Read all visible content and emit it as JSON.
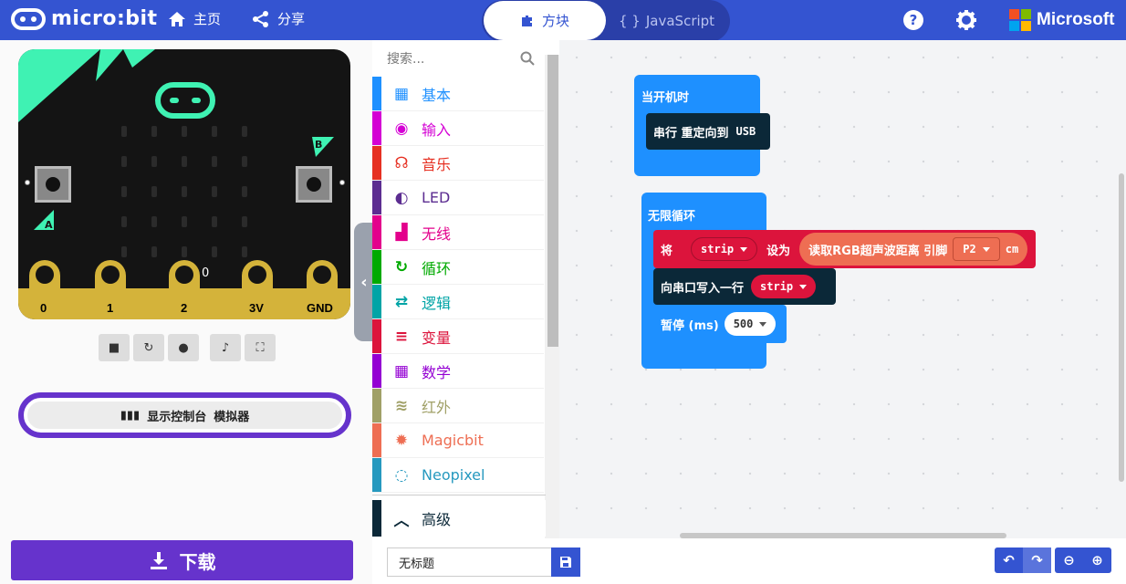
{
  "header": {
    "logo_text": "micro:bit",
    "home_label": "主页",
    "share_label": "分享",
    "mode_blocks": "方块",
    "mode_javascript": "JavaScript",
    "brand": "Microsoft",
    "help_icon": "help-icon",
    "settings_icon": "gear-icon"
  },
  "simulator": {
    "pin_labels": [
      "0",
      "1",
      "2",
      "3V",
      "GND"
    ],
    "pin_readout": "0",
    "button_a": "A",
    "button_b": "B",
    "console_label": "显示控制台",
    "console_sub": "模拟器",
    "download_label": "下载"
  },
  "toolbox": {
    "search_placeholder": "搜索...",
    "categories": [
      {
        "label": "基本",
        "color": "#1E90FF",
        "icon": "grid-icon"
      },
      {
        "label": "输入",
        "color": "#D400D4",
        "icon": "target-icon"
      },
      {
        "label": "音乐",
        "color": "#E63022",
        "icon": "headphones-icon"
      },
      {
        "label": "LED",
        "color": "#5C2D91",
        "icon": "toggle-icon"
      },
      {
        "label": "无线",
        "color": "#E3008C",
        "icon": "signal-icon"
      },
      {
        "label": "循环",
        "color": "#00AA00",
        "icon": "refresh-icon"
      },
      {
        "label": "逻辑",
        "color": "#00A4A6",
        "icon": "shuffle-icon"
      },
      {
        "label": "变量",
        "color": "#DC143C",
        "icon": "list-icon"
      },
      {
        "label": "数学",
        "color": "#9400D3",
        "icon": "calculator-icon"
      },
      {
        "label": "红外",
        "color": "#A0A067",
        "icon": "wifi-icon"
      },
      {
        "label": "Magicbit",
        "color": "#EE6E53",
        "icon": "gear-icon"
      },
      {
        "label": "Neopixel",
        "color": "#2699BF",
        "icon": "dots-circle-icon"
      }
    ],
    "advanced_label": "高级"
  },
  "workspace": {
    "on_start": "当开机时",
    "serial_redirect": "串行 重定向到",
    "usb": "USB",
    "forever": "无限循环",
    "set_label": "将",
    "var_strip": "strip",
    "set_to": "设为",
    "read_rgb": "读取RGB超声波距离 引脚",
    "pin_p2": "P2",
    "cm": "cm",
    "serial_write_line": "向串口写入一行",
    "pause_label": "暂停 (ms)",
    "pause_value": "500"
  },
  "bottom": {
    "project_name": "无标题"
  }
}
